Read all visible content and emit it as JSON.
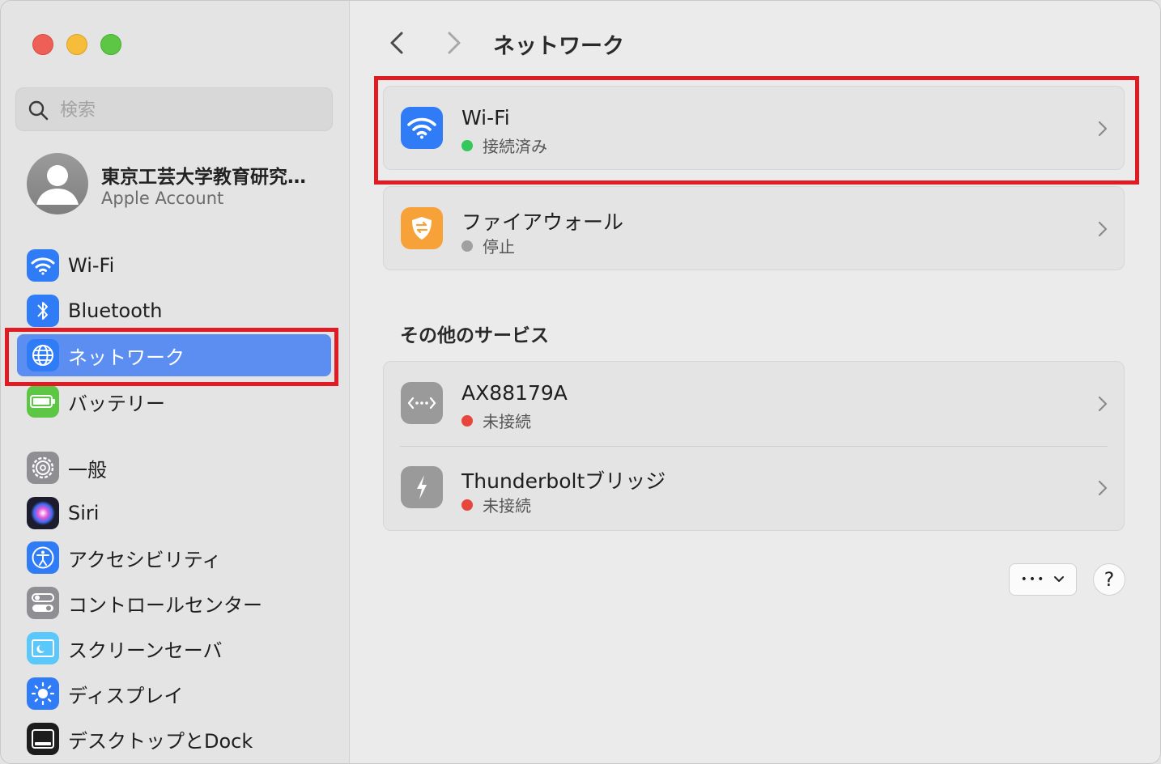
{
  "window": {
    "controls": [
      "close",
      "minimize",
      "zoom"
    ]
  },
  "sidebar": {
    "search": {
      "placeholder": "検索",
      "value": ""
    },
    "account": {
      "name": "東京工芸大学教育研究…",
      "subtitle": "Apple Account"
    },
    "items": [
      {
        "label": "Wi-Fi",
        "icon": "wifi-icon",
        "color": "#2f7cf6"
      },
      {
        "label": "Bluetooth",
        "icon": "bluetooth-icon",
        "color": "#2f7cf6"
      },
      {
        "label": "ネットワーク",
        "icon": "globe-icon",
        "color": "#2f7cf6",
        "selected": true
      },
      {
        "label": "バッテリー",
        "icon": "battery-icon",
        "color": "#5dc645"
      },
      {
        "label": "一般",
        "icon": "gear-icon",
        "color": "#8e8e93"
      },
      {
        "label": "Siri",
        "icon": "siri-icon",
        "color": "#1c1c2e"
      },
      {
        "label": "アクセシビリティ",
        "icon": "accessibility-icon",
        "color": "#2f7cf6"
      },
      {
        "label": "コントロールセンター",
        "icon": "control-center-icon",
        "color": "#8e8e93"
      },
      {
        "label": "スクリーンセーバ",
        "icon": "screensaver-icon",
        "color": "#5ac8fa"
      },
      {
        "label": "ディスプレイ",
        "icon": "display-brightness-icon",
        "color": "#2f7cf6"
      },
      {
        "label": "デスクトップとDock",
        "icon": "dock-icon",
        "color": "#1c1c1c"
      }
    ]
  },
  "main": {
    "title": "ネットワーク",
    "services": [
      {
        "name": "Wi-Fi",
        "status": "接続済み",
        "status_color": "#34c759",
        "icon": "wifi-icon",
        "icon_color": "#2f7cf6"
      },
      {
        "name": "ファイアウォール",
        "status": "停止",
        "status_color": "#a0a0a0",
        "icon": "firewall-icon",
        "icon_color": "#f7a238"
      }
    ],
    "other_title": "その他のサービス",
    "other_services": [
      {
        "name": "AX88179A",
        "status": "未接続",
        "status_color": "#e8453c",
        "icon": "ethernet-icon",
        "icon_color": "#9a9a9a"
      },
      {
        "name": "Thunderboltブリッジ",
        "status": "未接続",
        "status_color": "#e8453c",
        "icon": "thunderbolt-icon",
        "icon_color": "#9a9a9a"
      }
    ],
    "more_button": "•••",
    "help_button": "?"
  },
  "annotations": {
    "highlight_color": "#e01b24"
  }
}
